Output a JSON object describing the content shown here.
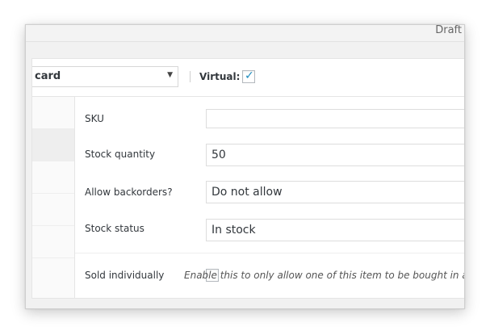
{
  "topbar": {
    "status_text": "Draft"
  },
  "product_data": {
    "type_select": {
      "value": "card",
      "arrow_icon": "caret-down-icon"
    },
    "virtual": {
      "label": "Virtual:",
      "checked": true
    },
    "tabs": {
      "active_index": 1
    }
  },
  "inventory": {
    "sku": {
      "label": "SKU",
      "value": ""
    },
    "stock_quantity": {
      "label": "Stock quantity",
      "value": "50"
    },
    "allow_backorders": {
      "label": "Allow backorders?",
      "value": "Do not allow"
    },
    "stock_status": {
      "label": "Stock status",
      "value": "In stock"
    },
    "sold_individually": {
      "label": "Sold individually",
      "checked": false,
      "description": "Enable this to only allow one of this item to be bought in a single order"
    }
  },
  "colors": {
    "accent": "#1e8cbe",
    "border": "#dddddd"
  }
}
